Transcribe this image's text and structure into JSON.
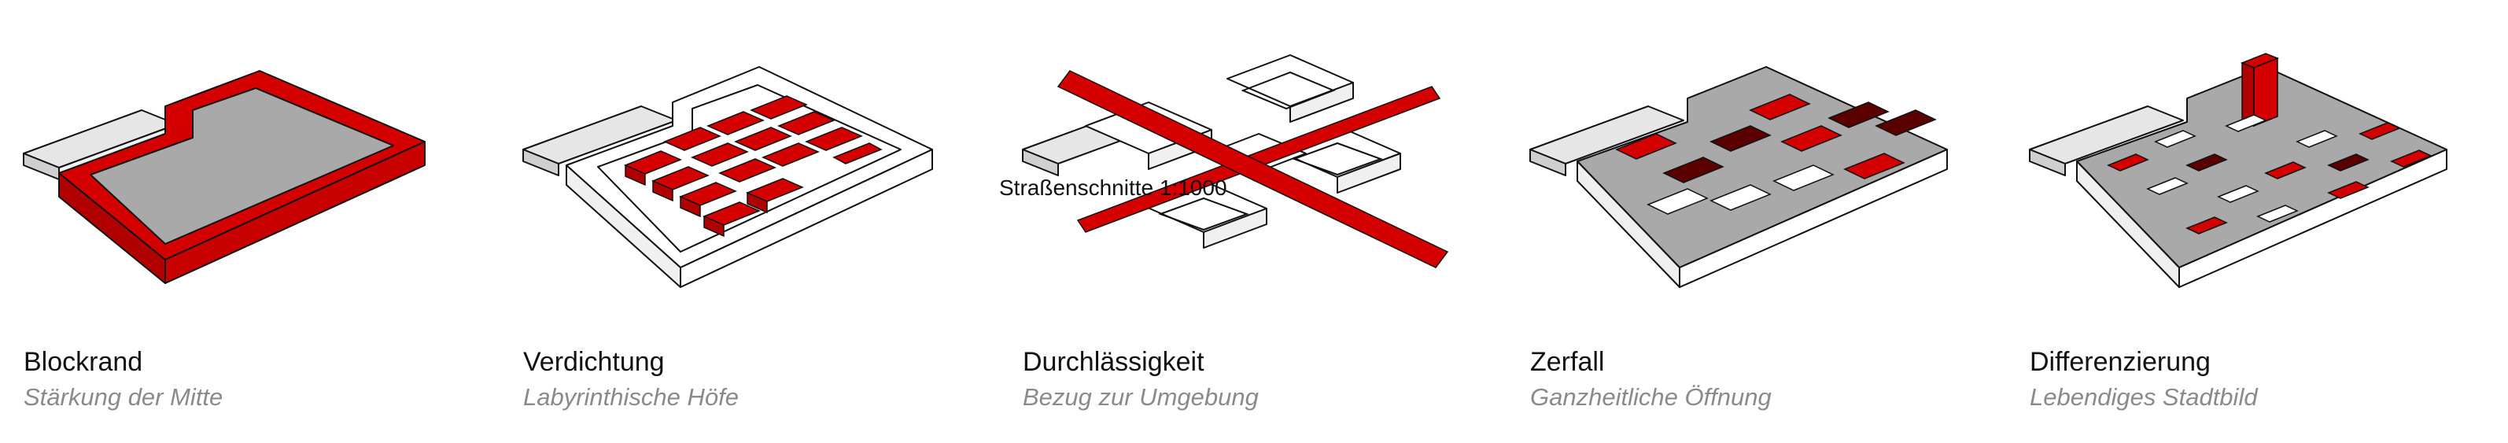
{
  "panels": [
    {
      "title": "Blockrand",
      "subtitle": "Stärkung der Mitte"
    },
    {
      "title": "Verdichtung",
      "subtitle": "Labyrinthische Höfe"
    },
    {
      "title": "Durchlässigkeit",
      "subtitle": "Bezug zur Umgebung",
      "overlay": "Straßenschnitte 1:1000"
    },
    {
      "title": "Zerfall",
      "subtitle": "Ganzheitliche Öffnung"
    },
    {
      "title": "Differenzierung",
      "subtitle": "Lebendiges Stadtbild"
    }
  ],
  "colors": {
    "red": "#d40000",
    "dark_red": "#5a0000",
    "gray": "#9b9b9b",
    "white": "#ffffff",
    "line": "#111111"
  }
}
